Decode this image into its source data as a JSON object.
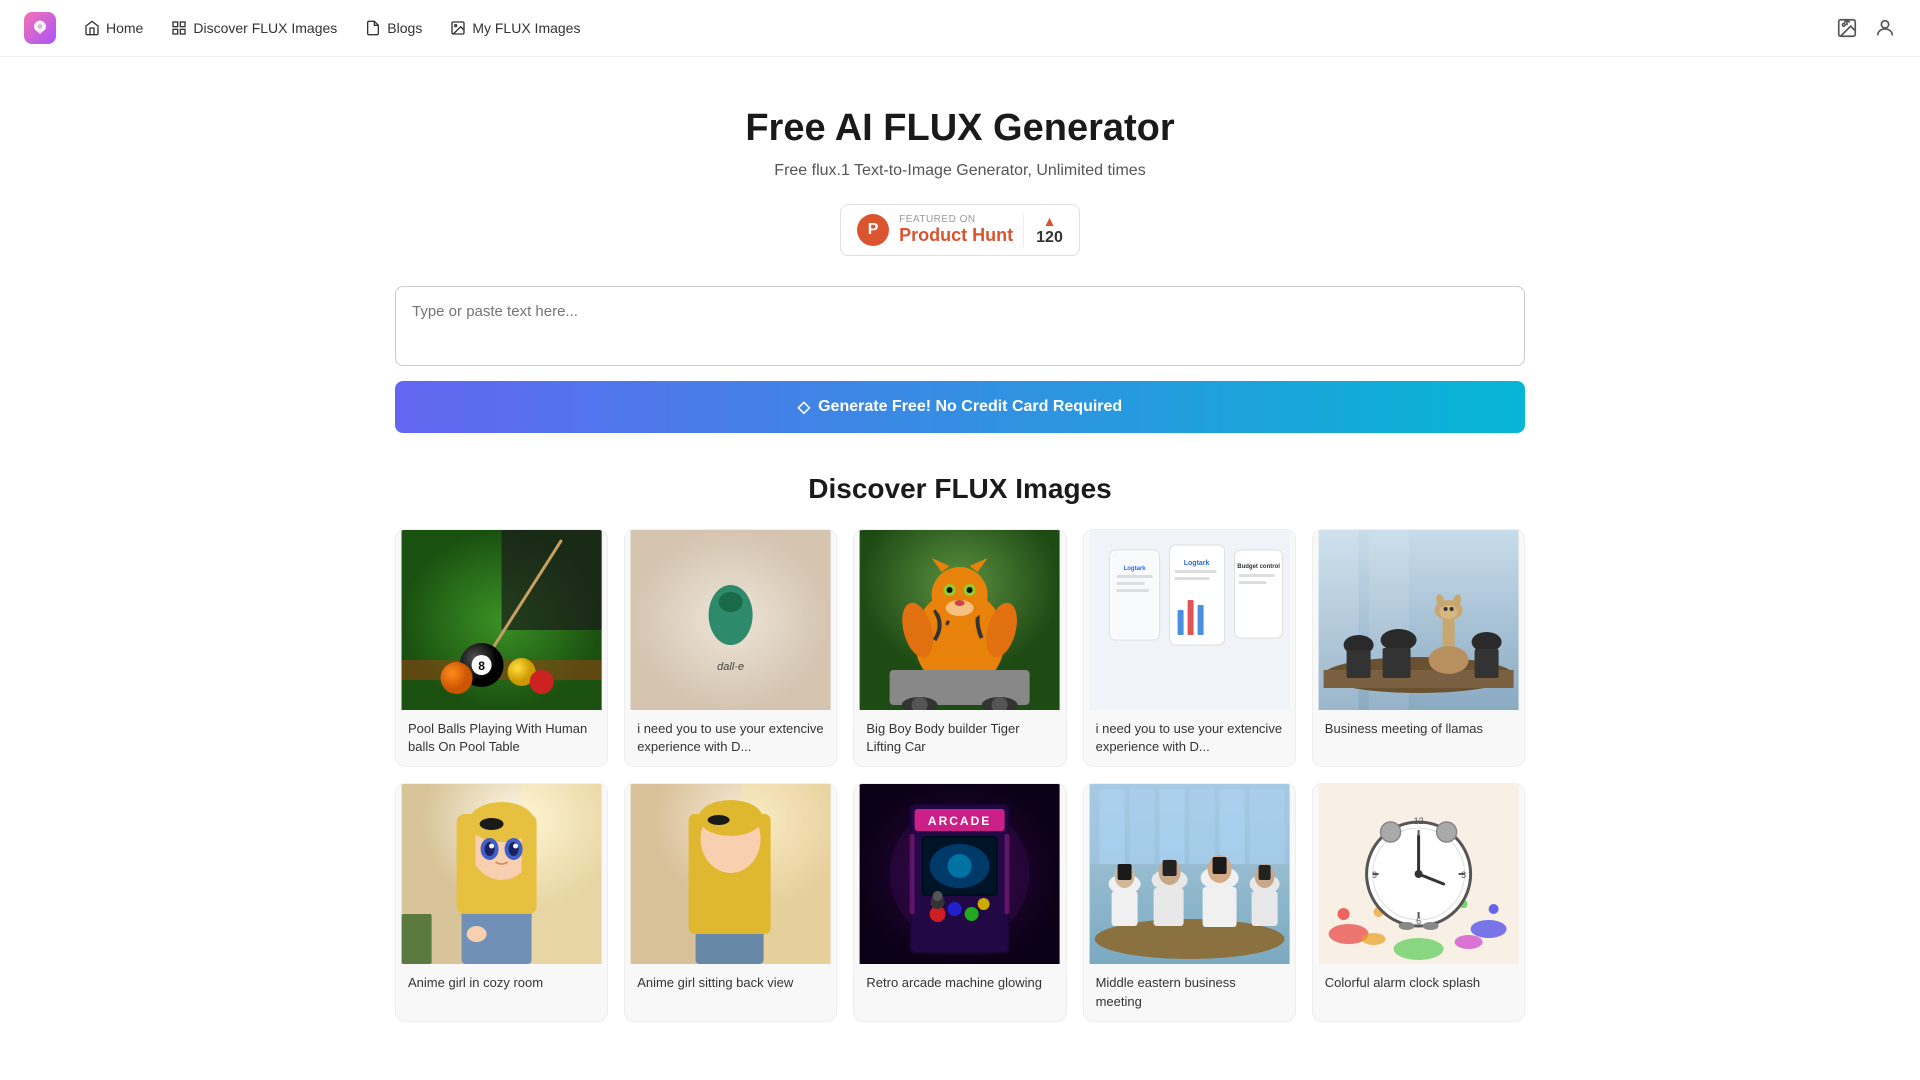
{
  "nav": {
    "logo_symbol": "✦",
    "items": [
      {
        "label": "Home",
        "icon": "home"
      },
      {
        "label": "Discover FLUX Images",
        "icon": "grid"
      },
      {
        "label": "Blogs",
        "icon": "file"
      },
      {
        "label": "My FLUX Images",
        "icon": "image"
      }
    ]
  },
  "hero": {
    "title": "Free AI FLUX Generator",
    "subtitle": "Free flux.1 Text-to-Image Generator, Unlimited times",
    "product_hunt": {
      "featured_label": "FEATURED ON",
      "name": "Product Hunt",
      "count": "120"
    }
  },
  "generator": {
    "placeholder": "Type or paste text here...",
    "button_label": "Generate Free! No Credit Card Required",
    "button_icon": "◇"
  },
  "discover": {
    "title": "Discover FLUX Images",
    "row1": [
      {
        "label": "Pool Balls Playing With Human balls On Pool Table",
        "type": "pool"
      },
      {
        "label": "i need you to use your extencive experience with D...",
        "type": "dali"
      },
      {
        "label": "Big Boy Body builder Tiger Lifting Car",
        "type": "tiger"
      },
      {
        "label": "i need you to use your extencive experience with D...",
        "type": "loge"
      },
      {
        "label": "Business meeting of llamas",
        "type": "llama"
      }
    ],
    "row2": [
      {
        "label": "Anime girl in cozy room",
        "type": "anime1"
      },
      {
        "label": "Anime girl sitting back view",
        "type": "anime2"
      },
      {
        "label": "Retro arcade machine glowing",
        "type": "arcade"
      },
      {
        "label": "Middle eastern business meeting",
        "type": "mideast"
      },
      {
        "label": "Colorful alarm clock splash",
        "type": "clock"
      }
    ]
  }
}
